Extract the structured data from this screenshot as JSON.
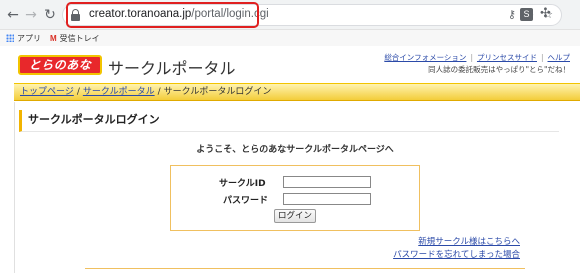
{
  "browser": {
    "nav": {
      "back_icon": "arrow-left",
      "forward_icon": "arrow-right",
      "reload_icon": "reload"
    },
    "address": {
      "host": "creator.toranoana.jp",
      "path": "/portal/login.cgi"
    },
    "icons": {
      "key": "⚷",
      "zoom": "⊕",
      "star": "☆",
      "extension_s": "S",
      "puzzle": "✣"
    },
    "bookmarks": [
      {
        "label": "アプリ",
        "icon": "apps-grid"
      },
      {
        "label": "受信トレイ",
        "icon": "gmail"
      }
    ],
    "highlight_color": "#e02020"
  },
  "site": {
    "logo_text": "とらのあな",
    "title": "サークルポータル",
    "top_links": [
      "総合インフォメーション",
      "プリンセスサイド",
      "ヘルプ"
    ],
    "tagline": "同人誌の委託販売はやっぱり\"とら\"だね！",
    "breadcrumb": {
      "items": [
        "トップページ",
        "サークルポータル"
      ],
      "current": "サークルポータルログイン"
    },
    "heading": "サークルポータルログイン",
    "welcome": "ようこそ、とらのあなサークルポータルページへ",
    "form": {
      "id_label": "サークルID",
      "password_label": "パスワード",
      "id_value": "",
      "password_value": "",
      "submit_label": "ログイン"
    },
    "links": {
      "new_circle": "新規サークル様はこちらへ",
      "forgot_password": "パスワードを忘れてしまった場合"
    },
    "colors": {
      "accent": "#f2c400",
      "logo_bg": "#e8282b",
      "link": "#2b4aa8"
    }
  }
}
